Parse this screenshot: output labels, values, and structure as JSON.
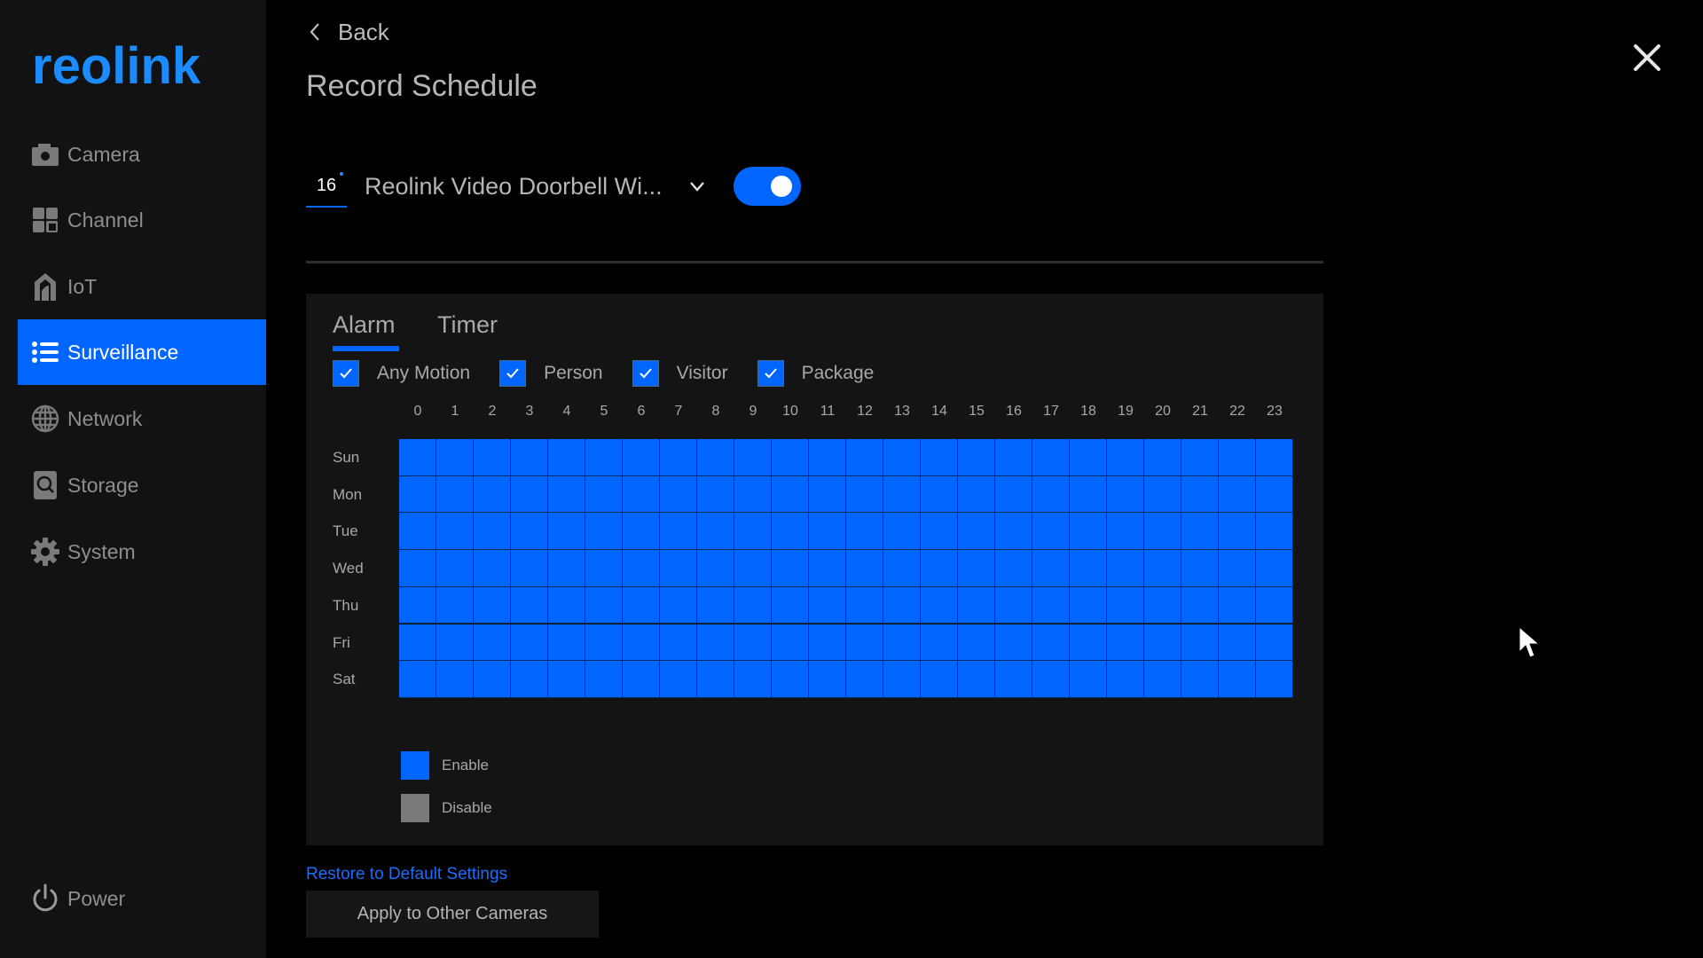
{
  "brand": {
    "logo_text": "reolink",
    "accent_color": "#0066ff",
    "logo_color": "#1fa8ff"
  },
  "sidebar": {
    "items": [
      {
        "label": "Camera",
        "icon": "camera-icon",
        "active": false
      },
      {
        "label": "Channel",
        "icon": "channel-grid-icon",
        "active": false
      },
      {
        "label": "IoT",
        "icon": "iot-house-icon",
        "active": false
      },
      {
        "label": "Surveillance",
        "icon": "list-icon",
        "active": true
      },
      {
        "label": "Network",
        "icon": "globe-icon",
        "active": false
      },
      {
        "label": "Storage",
        "icon": "storage-icon",
        "active": false
      },
      {
        "label": "System",
        "icon": "gear-icon",
        "active": false
      }
    ],
    "power": {
      "label": "Power",
      "icon": "power-icon"
    }
  },
  "header": {
    "back_label": "Back",
    "title": "Record Schedule",
    "close_icon": "close-icon"
  },
  "channel": {
    "number": "16",
    "name": "Reolink Video Doorbell Wi...",
    "enabled": true
  },
  "tabs": [
    {
      "label": "Alarm",
      "active": true
    },
    {
      "label": "Timer",
      "active": false
    }
  ],
  "alarm_types": [
    {
      "label": "Any Motion",
      "checked": true
    },
    {
      "label": "Person",
      "checked": true
    },
    {
      "label": "Visitor",
      "checked": true
    },
    {
      "label": "Package",
      "checked": true
    }
  ],
  "schedule": {
    "hours": [
      "0",
      "1",
      "2",
      "3",
      "4",
      "5",
      "6",
      "7",
      "8",
      "9",
      "10",
      "11",
      "12",
      "13",
      "14",
      "15",
      "16",
      "17",
      "18",
      "19",
      "20",
      "21",
      "22",
      "23"
    ],
    "days": [
      "Sun",
      "Mon",
      "Tue",
      "Wed",
      "Thu",
      "Fri",
      "Sat"
    ],
    "all_enabled": true
  },
  "legend": [
    {
      "label": "Enable",
      "color": "#0066ff"
    },
    {
      "label": "Disable",
      "color": "#7a7a7a"
    }
  ],
  "footer": {
    "restore_label": "Restore to Default Settings",
    "apply_label": "Apply to Other Cameras"
  }
}
